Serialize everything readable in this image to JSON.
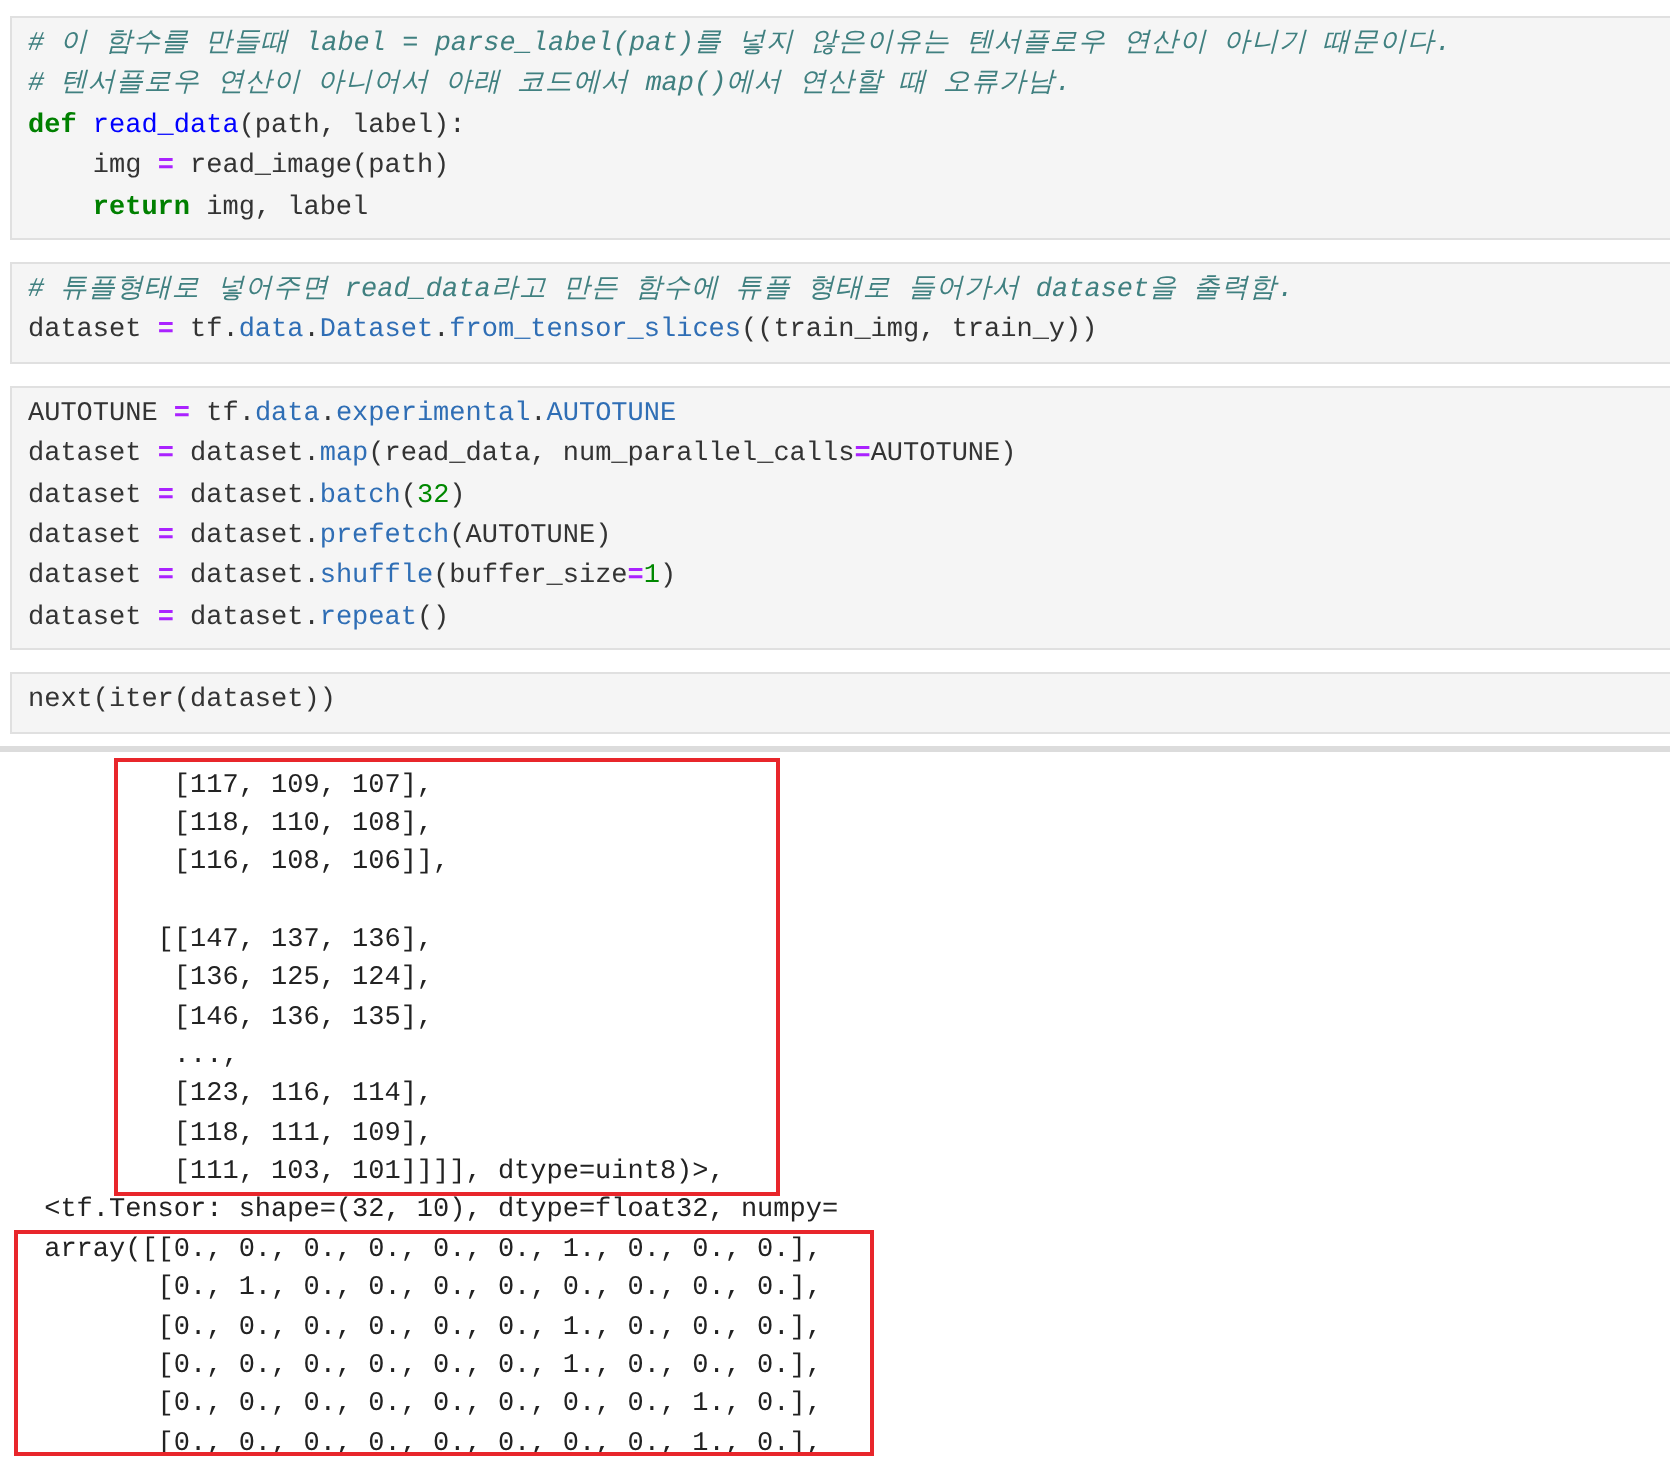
{
  "cells": [
    {
      "lines": [
        [
          {
            "t": "# 이 함수를 만들때 label = parse_label(pat)를 넣지 않은이유는 텐서플로우 연산이 아니기 때문이다.",
            "kind": "comment"
          }
        ],
        [
          {
            "t": "# 텐서플로우 연산이 아니어서 아래 코드에서 map()에서 연산할 때 오류가남.",
            "kind": "comment"
          }
        ],
        [
          {
            "t": "def ",
            "kind": "keyword"
          },
          {
            "t": "read_data",
            "kind": "defname"
          },
          {
            "t": "(path, label):",
            "kind": "plain"
          }
        ],
        [
          {
            "t": "    img ",
            "kind": "plain"
          },
          {
            "t": "=",
            "kind": "op"
          },
          {
            "t": " read_image(path)",
            "kind": "plain"
          }
        ],
        [
          {
            "t": "    return",
            "kind": "keyword"
          },
          {
            "t": " img, label",
            "kind": "plain"
          }
        ]
      ]
    },
    {
      "lines": [
        [
          {
            "t": "# 튜플형태로 넣어주면 read_data라고 만든 함수에 튜플 형태로 들어가서 dataset을 출력함.",
            "kind": "comment"
          }
        ],
        [
          {
            "t": "dataset ",
            "kind": "plain"
          },
          {
            "t": "=",
            "kind": "op"
          },
          {
            "t": " tf.",
            "kind": "plain"
          },
          {
            "t": "data",
            "kind": "prop"
          },
          {
            "t": ".",
            "kind": "plain"
          },
          {
            "t": "Dataset",
            "kind": "prop"
          },
          {
            "t": ".",
            "kind": "plain"
          },
          {
            "t": "from_tensor_slices",
            "kind": "prop"
          },
          {
            "t": "((train_img, train_y))",
            "kind": "plain"
          }
        ]
      ]
    },
    {
      "lines": [
        [
          {
            "t": "AUTOTUNE ",
            "kind": "plain"
          },
          {
            "t": "=",
            "kind": "op"
          },
          {
            "t": " tf.",
            "kind": "plain"
          },
          {
            "t": "data",
            "kind": "prop"
          },
          {
            "t": ".",
            "kind": "plain"
          },
          {
            "t": "experimental",
            "kind": "prop"
          },
          {
            "t": ".",
            "kind": "plain"
          },
          {
            "t": "AUTOTUNE",
            "kind": "prop"
          }
        ],
        [
          {
            "t": "dataset ",
            "kind": "plain"
          },
          {
            "t": "=",
            "kind": "op"
          },
          {
            "t": " dataset.",
            "kind": "plain"
          },
          {
            "t": "map",
            "kind": "prop"
          },
          {
            "t": "(read_data, num_parallel_calls",
            "kind": "plain"
          },
          {
            "t": "=",
            "kind": "op"
          },
          {
            "t": "AUTOTUNE)",
            "kind": "plain"
          }
        ],
        [
          {
            "t": "dataset ",
            "kind": "plain"
          },
          {
            "t": "=",
            "kind": "op"
          },
          {
            "t": " dataset.",
            "kind": "plain"
          },
          {
            "t": "batch",
            "kind": "prop"
          },
          {
            "t": "(",
            "kind": "plain"
          },
          {
            "t": "32",
            "kind": "num"
          },
          {
            "t": ")",
            "kind": "plain"
          }
        ],
        [
          {
            "t": "dataset ",
            "kind": "plain"
          },
          {
            "t": "=",
            "kind": "op"
          },
          {
            "t": " dataset.",
            "kind": "plain"
          },
          {
            "t": "prefetch",
            "kind": "prop"
          },
          {
            "t": "(AUTOTUNE)",
            "kind": "plain"
          }
        ],
        [
          {
            "t": "dataset ",
            "kind": "plain"
          },
          {
            "t": "=",
            "kind": "op"
          },
          {
            "t": " dataset.",
            "kind": "plain"
          },
          {
            "t": "shuffle",
            "kind": "prop"
          },
          {
            "t": "(buffer_size",
            "kind": "plain"
          },
          {
            "t": "=",
            "kind": "op"
          },
          {
            "t": "1",
            "kind": "num"
          },
          {
            "t": ")",
            "kind": "plain"
          }
        ],
        [
          {
            "t": "dataset ",
            "kind": "plain"
          },
          {
            "t": "=",
            "kind": "op"
          },
          {
            "t": " dataset.",
            "kind": "plain"
          },
          {
            "t": "repeat",
            "kind": "prop"
          },
          {
            "t": "()",
            "kind": "plain"
          }
        ]
      ]
    },
    {
      "lines": [
        [
          {
            "t": "next(iter(dataset))",
            "kind": "plain"
          }
        ]
      ]
    }
  ],
  "output": [
    {
      "boxed": true,
      "parts": [
        [
          "         [117, 109, 107],",
          "         [118, 110, 108],",
          "         [116, 108, 106]],"
        ],
        [
          "        [[147, 137, 136],",
          "         [136, 125, 124],",
          "         [146, 136, 135],",
          "         ...,",
          "         [123, 116, 114],",
          "         [118, 111, 109],",
          "         [111, 103, 101]]]], dtype=uint8)>,"
        ]
      ]
    },
    {
      "boxed": false,
      "parts": [
        [
          " <tf.Tensor: shape=(32, 10), dtype=float32, numpy="
        ]
      ]
    },
    {
      "boxed": true,
      "parts": [
        [
          " array([[0., 0., 0., 0., 0., 0., 1., 0., 0., 0.],",
          "        [0., 1., 0., 0., 0., 0., 0., 0., 0., 0.],",
          "        [0., 0., 0., 0., 0., 0., 1., 0., 0., 0.],",
          "        [0., 0., 0., 0., 0., 0., 1., 0., 0., 0.],",
          "        [0., 0., 0., 0., 0., 0., 0., 0., 1., 0.],",
          "        [0., 0., 0., 0., 0., 0., 0., 0., 1., 0.],"
        ]
      ]
    }
  ]
}
